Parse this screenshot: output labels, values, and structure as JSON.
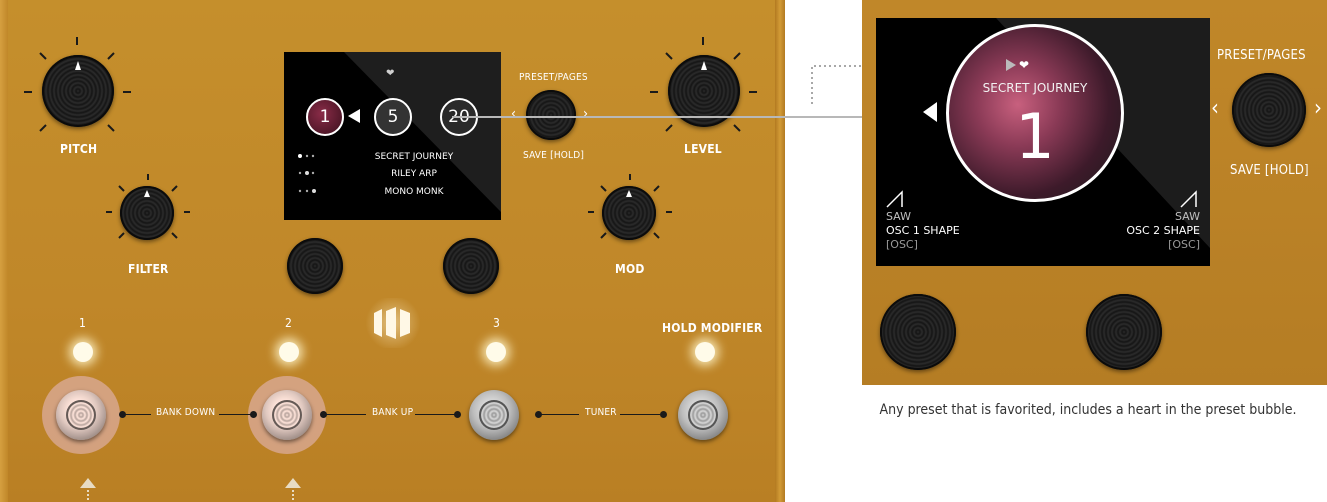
{
  "pedal": {
    "knobs": {
      "pitch": "PITCH",
      "level": "LEVEL",
      "filter": "FILTER",
      "mod": "MOD"
    },
    "screen": {
      "heart": "❤",
      "bubbles": [
        "1",
        "5",
        "20"
      ],
      "presets": [
        "SECRET JOURNEY",
        "RILEY ARP",
        "MONO MONK"
      ]
    },
    "preset_pages": "PRESET/PAGES",
    "save_hold": "SAVE [HOLD]",
    "switch_numbers": [
      "1",
      "2",
      "3"
    ],
    "hold_modifier": "HOLD MODIFIER",
    "bank_down": "BANK DOWN",
    "bank_up": "BANK UP",
    "tuner": "TUNER"
  },
  "zoom": {
    "preset_name": "SECRET JOURNEY",
    "preset_number": "1",
    "heart": "❤",
    "preset_pages": "PRESET/PAGES",
    "save_hold": "SAVE [HOLD]",
    "osc1": {
      "wave": "SAW",
      "name": "OSC 1 SHAPE",
      "group": "[OSC]"
    },
    "osc2": {
      "wave": "SAW",
      "name": "OSC 2 SHAPE",
      "group": "[OSC]"
    }
  },
  "caption": "Any preset that is favorited, includes a heart in the preset bubble.",
  "colors": {
    "pedal_body": "#c08729",
    "screen": "#000000",
    "led": "#fffbe9",
    "halo": "#e8bcc8"
  }
}
